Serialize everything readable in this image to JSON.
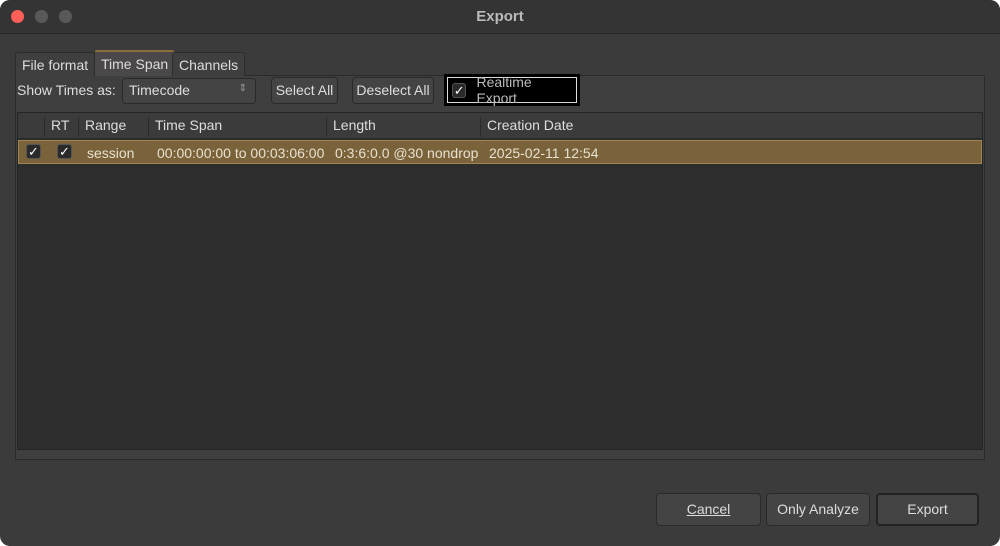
{
  "window": {
    "title": "Export"
  },
  "tabs": [
    "File format",
    "Time Span",
    "Channels"
  ],
  "toolbar": {
    "show_times_label": "Show Times as:",
    "show_times_value": "Timecode",
    "select_all": "Select All",
    "deselect_all": "Deselect All",
    "realtime_export": "Realtime Export",
    "realtime_checked": true
  },
  "table": {
    "columns": [
      "",
      "RT",
      "Range",
      "Time Span",
      "Length",
      "Creation Date"
    ],
    "rows": [
      {
        "selected": true,
        "rt": true,
        "range": "session",
        "time_span": "00:00:00:00 to 00:03:06:00",
        "length": "0:3:6:0.0 @30 nondrop",
        "creation_date": "2025-02-11 12:54"
      }
    ]
  },
  "buttons": {
    "cancel": "Cancel",
    "only_analyze": "Only Analyze",
    "export": "Export"
  },
  "colors": {
    "row_highlight": "#7a633a",
    "background": "#3c3b3b"
  }
}
